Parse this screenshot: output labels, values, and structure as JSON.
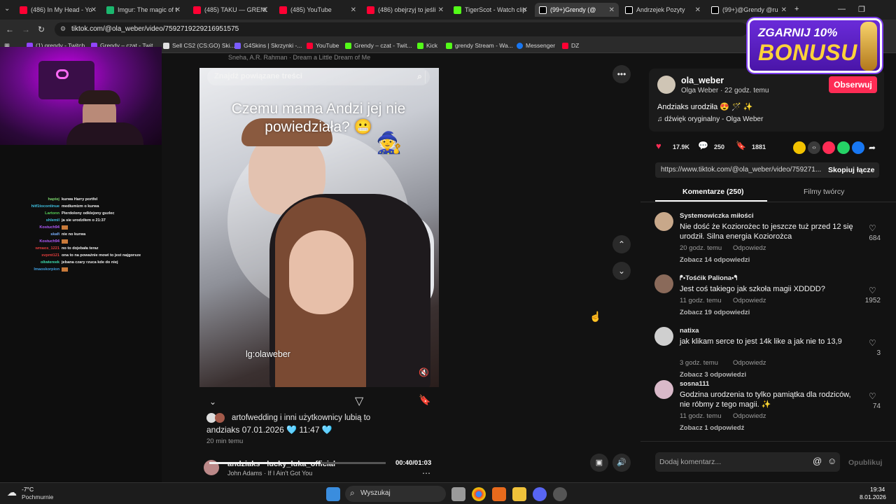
{
  "browser": {
    "tabs": [
      {
        "title": "(486) In My Head - Yo",
        "color": "#ff0033"
      },
      {
        "title": "Imgur: The magic of t",
        "color": "#1bb76e"
      },
      {
        "title": "(485) TAKU — GRENDY",
        "color": "#ff0033"
      },
      {
        "title": "(485) YouTube",
        "color": "#ff0033"
      },
      {
        "title": "(486) obejrzyj to jeśli",
        "color": "#ff0033"
      },
      {
        "title": "TigerScot - Watch clip",
        "color": "#53fc18"
      },
      {
        "title": "(99+)Grendy (@",
        "color": "#ffffff"
      },
      {
        "title": "Andrzejek Pozyty",
        "color": "#ffffff"
      },
      {
        "title": "(99+)@Grendy @ru",
        "color": "#ffffff"
      }
    ],
    "url": "tiktok.com/@ola_weber/video/7592719229216951575",
    "bookmarks": [
      {
        "label": "(1) grendy - Twitch",
        "color": "#9146ff"
      },
      {
        "label": "Grendy – czat - Twit",
        "color": "#9146ff"
      },
      {
        "label": "Sell CS2 (CS:GO) Ski...",
        "color": "#e0e0e0"
      },
      {
        "label": "G4Skins | Skrzynki -...",
        "color": "#7b5cff"
      },
      {
        "label": "YouTube",
        "color": "#ff0033"
      },
      {
        "label": "Grendy – czat - Twit...",
        "color": "#53fc18"
      },
      {
        "label": "Kick",
        "color": "#53fc18"
      },
      {
        "label": "grendy Stream - Wa...",
        "color": "#53fc18"
      },
      {
        "label": "Messenger",
        "color": "#1877f2"
      },
      {
        "label": "DZ",
        "color": "#ff0033"
      }
    ]
  },
  "stream_chat": [
    {
      "user": "haptej",
      "msg": "kurwa Harry portfel",
      "color": "#7ad36b"
    },
    {
      "user": "hitf1tocontinue",
      "msg": "mediumizm o kurwa",
      "color": "#3fc0e0"
    },
    {
      "user": "Lartonn",
      "msg": "Pierdolony odklejony guzlec",
      "color": "#56d056"
    },
    {
      "user": "shlemil",
      "msg": "ja sie urodziłem o 21:37",
      "color": "#3fc0e0"
    },
    {
      "user": "Kostuch94",
      "msg": "",
      "color": "#b35cff"
    },
    {
      "user": "skafi",
      "msg": "nie no kurwa",
      "color": "#7ab0ff"
    },
    {
      "user": "Kostuch94",
      "msg": "",
      "color": "#b35cff"
    },
    {
      "user": "wmaos_1221",
      "msg": "no to dojebała teraz",
      "color": "#e03c3c"
    },
    {
      "user": "svpmt121",
      "msg": "ona to na poważnie mowi to jest najgorsze",
      "color": "#e03c3c"
    },
    {
      "user": "oliwiereek",
      "msg": "jebana czary rzuca kde do niej",
      "color": "#3fe0b0"
    },
    {
      "user": "lmaoskorpion",
      "msg": "",
      "color": "#3f9fe0"
    }
  ],
  "video": {
    "top_song": "Sneha, A.R. Rahman · Dream a Little Dream of Me",
    "search_placeholder": "Znajdź powiązane treści",
    "caption": "Czemu mama Andzi jej nie powiedziała? 😬",
    "watermark": "lg:olaweber",
    "likers": "artofwedding i inni użytkownicy lubią to",
    "post_text": "andziaks 07.01.2026 🩵 11:47 🩵",
    "post_time": "20 min temu",
    "next_author": "andziaks · lucky_luka_official",
    "next_song": "John Adams · If I Ain't Got You",
    "timestamp": "00:40/01:03",
    "progress": 0.63
  },
  "post": {
    "username": "ola_weber",
    "display_name": "Olga Weber · 22 godz. temu",
    "follow_label": "Obserwuj",
    "description": "Andziaks urodziła 😍 🪄 ✨",
    "sound": "dźwięk oryginalny - Olga Weber",
    "likes": "17.9K",
    "comments": "250",
    "saves": "1881",
    "link": "https://www.tiktok.com/@ola_weber/video/759271...",
    "copy_label": "Skopiuj łącze",
    "tab_comments": "Komentarze (250)",
    "tab_creator": "Filmy twórcy"
  },
  "comments": [
    {
      "user": "Systemowiczka miłości",
      "text": "Nie dość że Koziorożec to jeszcze tuż przed 12 się urodził. Silna energia Koziorożca",
      "meta": "20 godz. temu",
      "reply": "Odpowiedz",
      "more": "Zobacz 14 odpowiedzi",
      "likes": "684",
      "avatar": "#c8a88a"
    },
    {
      "user": "ᖰ•Tośćik Paliona•ᖳ",
      "text": "Jest coś takiego jak szkoła magii XDDDD?",
      "meta": "11 godz. temu",
      "reply": "Odpowiedz",
      "more": "Zobacz 19 odpowiedzi",
      "likes": "1952",
      "avatar": "#8a6a5a"
    },
    {
      "user": "natixa",
      "text": "jak klikam serce to jest 14k like a jak nie to 13,9",
      "meta": "3 godz. temu",
      "reply": "Odpowiedz",
      "more": "Zobacz 3 odpowiedzi",
      "likes": "3",
      "avatar": "#cfcfcf"
    },
    {
      "user": "sosna111",
      "text": "Godzina urodzenia to tylko pamiątka dla rodziców, nie róbmy z tego magii. ✨",
      "meta": "11 godz. temu",
      "reply": "Odpowiedz",
      "more": "Zobacz 1 odpowiedź",
      "likes": "74",
      "avatar": "#d9b9c9"
    }
  ],
  "comment_input": {
    "placeholder": "Dodaj komentarz...",
    "publish": "Opublikuj"
  },
  "banner": {
    "line1": "ZGARNIJ 10%",
    "line2": "BONUSU"
  },
  "taskbar": {
    "temp": "-7°C",
    "weather": "Pochmurnie",
    "search": "Wyszukaj",
    "time": "19:34",
    "date": "8.01.2026"
  }
}
